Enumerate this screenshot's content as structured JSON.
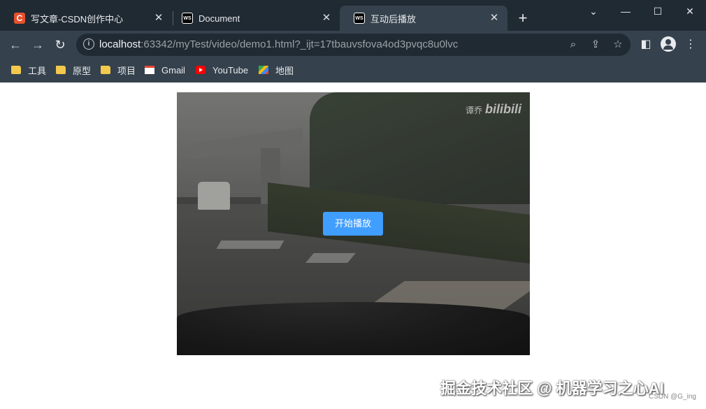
{
  "browser": {
    "tabs": [
      {
        "label": "写文章-CSDN创作中心",
        "favicon": "C",
        "active": false
      },
      {
        "label": "Document",
        "favicon": "WS",
        "active": false
      },
      {
        "label": "互动后播放",
        "favicon": "WS",
        "active": true
      }
    ],
    "close_glyph": "✕",
    "new_tab_glyph": "+",
    "window_controls": {
      "dropdown": "⌄",
      "minimize": "—",
      "maximize": "☐",
      "close": "✕"
    },
    "address": {
      "host": "localhost",
      "rest": ":63342/myTest/video/demo1.html?_ijt=17tbauvsfova4od3pvqc8u0lvc"
    },
    "bookmarks": [
      {
        "label": "工具",
        "icon": "folder-icon"
      },
      {
        "label": "原型",
        "icon": "folder-icon"
      },
      {
        "label": "项目",
        "icon": "folder-icon"
      },
      {
        "label": "Gmail",
        "icon": "gmail-icon"
      },
      {
        "label": "YouTube",
        "icon": "youtube-icon"
      },
      {
        "label": "地图",
        "icon": "maps-icon"
      }
    ]
  },
  "page": {
    "video_watermark_text": "谭乔",
    "video_watermark_logo": "bilibili",
    "play_button_label": "开始播放"
  },
  "overlay_watermark": "掘金技术社区 @ 机器学习之心AI",
  "csdn_watermark": "CSDN @G_ing",
  "colors": {
    "accent": "#409eff",
    "chrome_bg": "#35414c",
    "tabstrip_bg": "#202a33"
  }
}
